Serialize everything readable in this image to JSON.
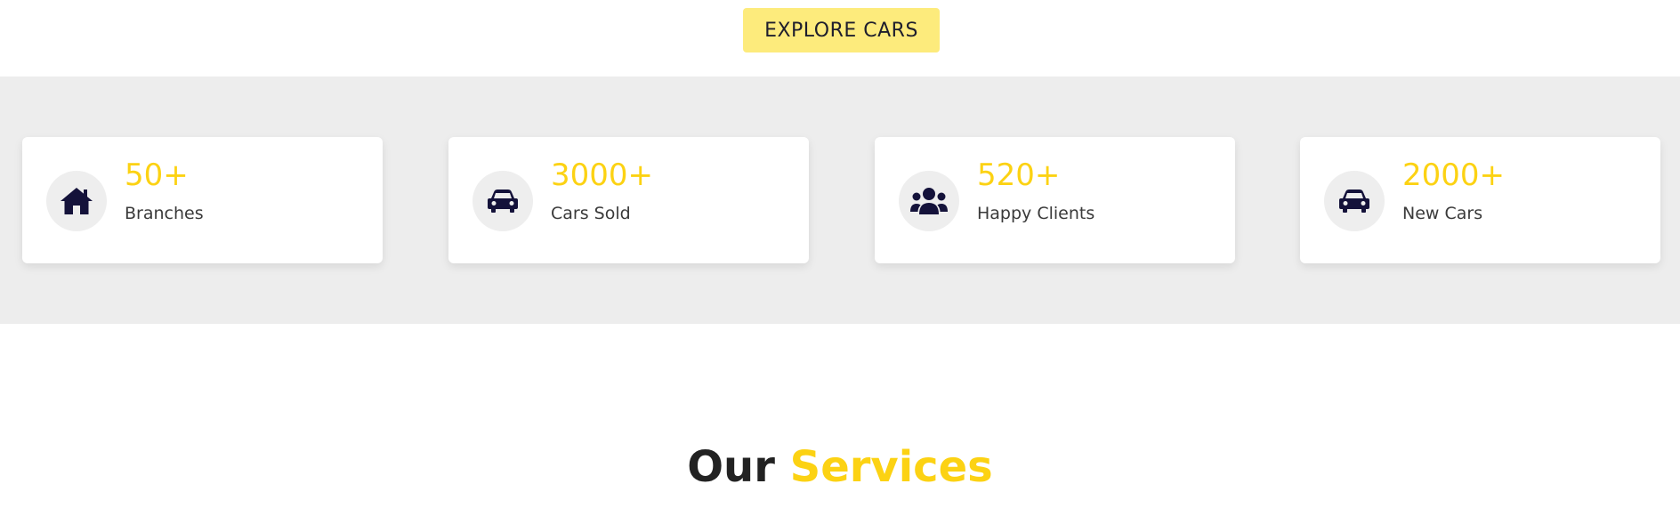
{
  "hero": {
    "cta_label": "EXPLORE CARS"
  },
  "stats": [
    {
      "icon": "home-icon",
      "number": "50+",
      "label": "Branches"
    },
    {
      "icon": "car-icon",
      "number": "3000+",
      "label": "Cars Sold"
    },
    {
      "icon": "users-icon",
      "number": "520+",
      "label": "Happy Clients"
    },
    {
      "icon": "car-icon",
      "number": "2000+",
      "label": "New Cars"
    }
  ],
  "services": {
    "heading_part1": "Our",
    "heading_part2": "Services"
  },
  "colors": {
    "accent": "#fcd213",
    "button_bg": "#fdeb7c",
    "band_bg": "#ededed",
    "icon_color": "#14123a",
    "heading_dark": "#222222"
  }
}
